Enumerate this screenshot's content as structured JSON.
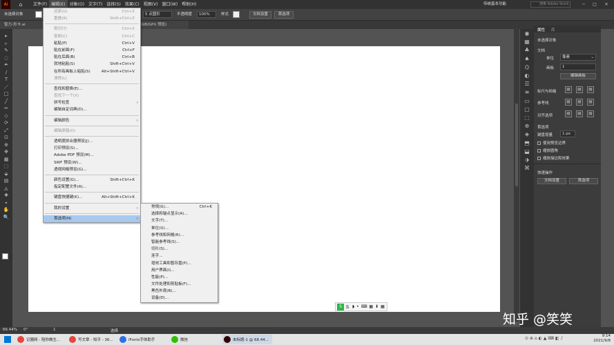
{
  "app": {
    "logo": "Ai"
  },
  "menubar": {
    "items": [
      "文件(F)",
      "编辑(E)",
      "对象(O)",
      "文字(T)",
      "选择(S)",
      "效果(C)",
      "视图(V)",
      "窗口(W)",
      "帮助(H)"
    ],
    "active_index": 1,
    "workspace_label": "传统基本功能",
    "search_placeholder": "搜索 Adobe Stock"
  },
  "control": {
    "selection_label": "未选择对象",
    "stroke_profile": "5 点圆形",
    "opacity_label": "不透明度",
    "opacity_value": "100%",
    "style_label": "样式",
    "doc_setup": "文档设置",
    "prefs": "首选项"
  },
  "doc_tab": {
    "title_part1": "智力-形卡.ai",
    "title_part2": "GB/GPU 预览)"
  },
  "edit_menu": [
    {
      "label": "还原(U)",
      "shortcut": "Ctrl+Z",
      "disabled": true
    },
    {
      "label": "重做(R)",
      "shortcut": "Shift+Ctrl+Z",
      "disabled": true
    },
    {
      "sep": true
    },
    {
      "label": "剪切(T)",
      "shortcut": "Ctrl+X",
      "disabled": true
    },
    {
      "label": "复制(C)",
      "shortcut": "Ctrl+C",
      "disabled": true
    },
    {
      "label": "粘贴(P)",
      "shortcut": "Ctrl+V"
    },
    {
      "label": "贴在前面(F)",
      "shortcut": "Ctrl+F"
    },
    {
      "label": "贴在后面(B)",
      "shortcut": "Ctrl+B"
    },
    {
      "label": "就地粘贴(S)",
      "shortcut": "Shift+Ctrl+V"
    },
    {
      "label": "在所有画板上粘贴(S)",
      "shortcut": "Alt+Shift+Ctrl+V"
    },
    {
      "label": "清除(L)",
      "disabled": true
    },
    {
      "sep": true
    },
    {
      "label": "查找和替换(E)..."
    },
    {
      "label": "查找下一个(X)",
      "disabled": true
    },
    {
      "label": "拼写检查",
      "submenu": true
    },
    {
      "label": "编辑自定词典(D)..."
    },
    {
      "sep": true
    },
    {
      "label": "编辑颜色",
      "submenu": true
    },
    {
      "sep": true
    },
    {
      "label": "编辑原稿(O)",
      "disabled": true
    },
    {
      "sep": true
    },
    {
      "label": "透明度拼合器预设(J)..."
    },
    {
      "label": "打印预设(S)..."
    },
    {
      "label": "Adobe PDF 预设(M)..."
    },
    {
      "label": "SWF 预设(W)..."
    },
    {
      "label": "透视网格预设(G)..."
    },
    {
      "sep": true
    },
    {
      "label": "颜色设置(G)...",
      "shortcut": "Shift+Ctrl+K"
    },
    {
      "label": "指定配置文件(A)..."
    },
    {
      "sep": true
    },
    {
      "label": "键盘快捷键(K)...",
      "shortcut": "Alt+Shift+Ctrl+K"
    },
    {
      "sep": true
    },
    {
      "label": "我的设置",
      "submenu": true
    },
    {
      "sep": true
    },
    {
      "label": "首选项(N)",
      "submenu": true,
      "highlighted": true
    }
  ],
  "prefs_submenu": [
    {
      "label": "常规(G)...",
      "shortcut": "Ctrl+K"
    },
    {
      "label": "选择和锚点显示(A)..."
    },
    {
      "label": "文字(T)..."
    },
    {
      "label": "单位(U)..."
    },
    {
      "label": "参考线和网格(R)..."
    },
    {
      "label": "智能参考线(S)..."
    },
    {
      "label": "切片(S)..."
    },
    {
      "label": "连字..."
    },
    {
      "label": "增效工具和暂存盘(P)..."
    },
    {
      "label": "用户界面(I)..."
    },
    {
      "label": "性能(P)..."
    },
    {
      "label": "文件处理和剪贴板(F)..."
    },
    {
      "label": "黑色外观(B)..."
    },
    {
      "label": "设备(D)..."
    }
  ],
  "properties": {
    "tabs": [
      "属性",
      "库"
    ],
    "no_selection": "未选择对象",
    "doc_heading": "文档",
    "unit_label": "单位",
    "unit_value": "像素",
    "artboard_label": "画板",
    "artboard_value": "1",
    "edit_artboards": "编辑画板",
    "rulers_grid": "标尺与网格",
    "guides": "参考线",
    "align": "对齐选项",
    "prefs_heading": "首选项",
    "keyboard_inc_label": "键盘增量",
    "keyboard_inc_value": "1 px",
    "chk1": "使用预览边界",
    "chk2": "缩放圆角",
    "chk3": "缩放描边和效果",
    "quick_actions": "快速操作",
    "doc_setup": "文档设置",
    "prefs_btn": "首选项"
  },
  "status": {
    "zoom": "66.44%",
    "rotation": "0°",
    "page": "1",
    "tool": "选择"
  },
  "ime": {
    "label": "五"
  },
  "watermark": "知乎 @笑笑",
  "taskbar": {
    "items": [
      {
        "label": "记圃网 - 陪你做生...",
        "color": "#e8453c"
      },
      {
        "label": "写文章 - 知乎 - 36...",
        "color": "#e8453c"
      },
      {
        "label": "iFonts字体助手",
        "color": "#2a6fe8"
      },
      {
        "label": "微信",
        "color": "#2dc100"
      },
      {
        "label": "未标题-1 @ 68.44...",
        "color": "#330000"
      }
    ],
    "time": "9:14",
    "date": "2021/9/8"
  }
}
